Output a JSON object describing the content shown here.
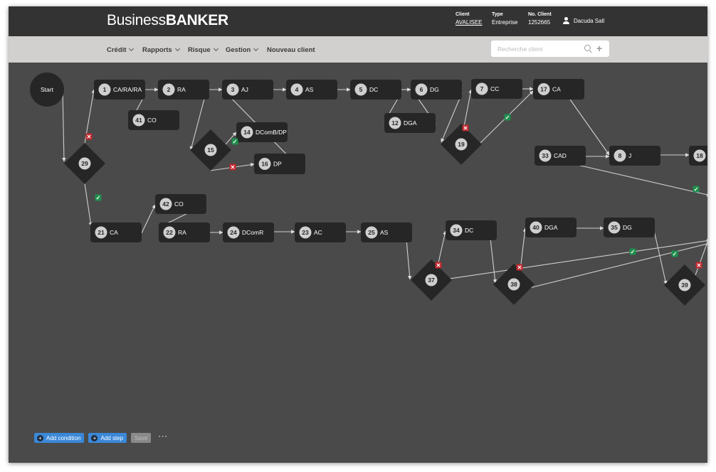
{
  "app": {
    "logo_light": "Business",
    "logo_bold": "BANKER"
  },
  "header": {
    "client_label": "Client",
    "client_value": "AVALISEE",
    "type_label": "Type",
    "type_value": "Entreprise",
    "no_label": "No. Client",
    "no_value": "1252665",
    "user_name": "Dacuda Sall"
  },
  "nav": {
    "items": [
      {
        "label": "Crédit",
        "has_dropdown": true
      },
      {
        "label": "Rapports",
        "has_dropdown": true
      },
      {
        "label": "Risque",
        "has_dropdown": true
      },
      {
        "label": "Gestion",
        "has_dropdown": true
      },
      {
        "label": "Nouveau client",
        "has_dropdown": false
      }
    ],
    "search_placeholder": "Recherche client"
  },
  "flow": {
    "start_label": "Start",
    "steps": [
      {
        "num": "1",
        "label": "CA/RA/RA"
      },
      {
        "num": "2",
        "label": "RA"
      },
      {
        "num": "3",
        "label": "AJ"
      },
      {
        "num": "4",
        "label": "AS"
      },
      {
        "num": "5",
        "label": "DC"
      },
      {
        "num": "6",
        "label": "DG"
      },
      {
        "num": "7",
        "label": "CC"
      },
      {
        "num": "17",
        "label": "CA"
      },
      {
        "num": "41",
        "label": "CO"
      },
      {
        "num": "14",
        "label": "DComB/DP"
      },
      {
        "num": "16",
        "label": "DP"
      },
      {
        "num": "12",
        "label": "DGA"
      },
      {
        "num": "33",
        "label": "CAD"
      },
      {
        "num": "8",
        "label": "J"
      },
      {
        "num": "18",
        "label": ""
      },
      {
        "num": "42",
        "label": "CO"
      },
      {
        "num": "21",
        "label": "CA"
      },
      {
        "num": "22",
        "label": "RA"
      },
      {
        "num": "24",
        "label": "DComR"
      },
      {
        "num": "23",
        "label": "AC"
      },
      {
        "num": "25",
        "label": "AS"
      },
      {
        "num": "34",
        "label": "DC"
      },
      {
        "num": "40",
        "label": "DGA"
      },
      {
        "num": "35",
        "label": "DG"
      }
    ],
    "conditions": [
      "29",
      "15",
      "19",
      "37",
      "38",
      "39"
    ]
  },
  "toolbar": {
    "add_condition": "Add condition",
    "add_step": "Add step",
    "save": "Save",
    "more": "···"
  },
  "colors": {
    "topbar": "#333333",
    "navbar": "#d2d0ce",
    "canvas": "#4a4a4a",
    "node": "#262626",
    "accent": "#3b88d8",
    "ok": "#1f8f4e",
    "fail": "#c0282d"
  }
}
